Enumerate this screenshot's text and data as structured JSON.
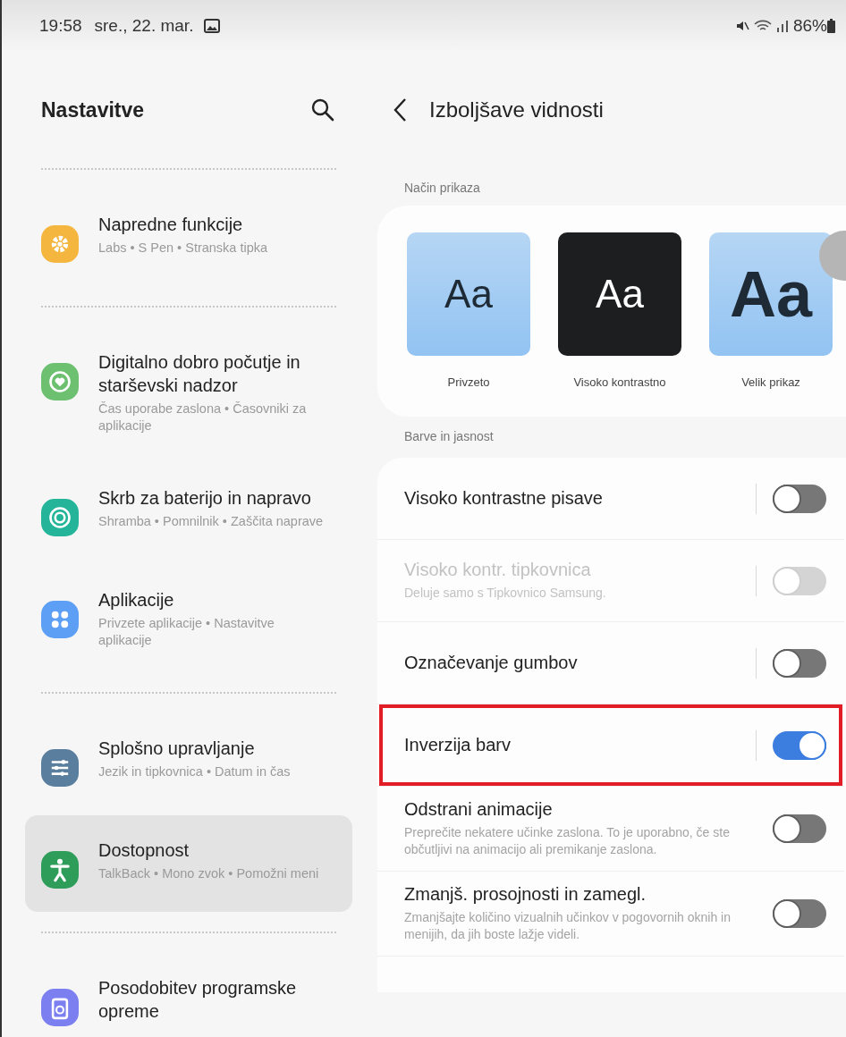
{
  "status_bar": {
    "time": "19:58",
    "date": "sre., 22. mar.",
    "battery": "86%"
  },
  "sidebar": {
    "title": "Nastavitve",
    "groups": [
      {
        "items": [
          {
            "color": "#f5b63f",
            "title": "Napredne funkcije",
            "subtitle": "Labs  •  S Pen  •  Stranska tipka",
            "selected": false
          }
        ]
      },
      {
        "items": [
          {
            "color": "#6cc070",
            "title": "Digitalno dobro počutje in starševski nadzor",
            "subtitle": "Čas uporabe zaslona  •  Časovniki za aplikacije",
            "selected": false
          },
          {
            "color": "#23b49a",
            "title": "Skrb za baterijo in napravo",
            "subtitle": "Shramba  •  Pomnilnik  •  Zaščita naprave",
            "selected": false
          },
          {
            "color": "#5c9ff5",
            "title": "Aplikacije",
            "subtitle": "Privzete aplikacije  •  Nastavitve aplikacije",
            "selected": false
          }
        ]
      },
      {
        "items": [
          {
            "color": "#5a7f9e",
            "title": "Splošno upravljanje",
            "subtitle": "Jezik in tipkovnica  •  Datum in čas",
            "selected": false
          },
          {
            "color": "#2e9d5a",
            "title": "Dostopnost",
            "subtitle": "TalkBack  •  Mono zvok  •  Pomožni meni",
            "selected": true
          }
        ]
      },
      {
        "items": [
          {
            "color": "#7b7ff0",
            "title": "Posodobitev programske opreme",
            "selected": false
          }
        ]
      }
    ]
  },
  "detail": {
    "title": "Izboljšave vidnosti",
    "display_section": "Način prikaza",
    "modes": [
      {
        "kind": "default",
        "sample": "Aa",
        "label": "Privzeto"
      },
      {
        "kind": "contrast",
        "sample": "Aa",
        "label": "Visoko kontrastno"
      },
      {
        "kind": "large",
        "sample": "Aa",
        "label": "Velik prikaz"
      }
    ],
    "color_section": "Barve in jasnost",
    "settings": [
      {
        "kind": "link_switch",
        "title": "Visoko kontrastne pisave",
        "on": false,
        "disabled": false,
        "highlighted": false
      },
      {
        "kind": "link_switch",
        "title": "Visoko kontr. tipkovnica",
        "description": "Deluje samo s Tipkovnico Samsung.",
        "on": false,
        "disabled": true,
        "highlighted": false
      },
      {
        "kind": "link_switch",
        "title": "Označevanje gumbov",
        "on": false,
        "disabled": false,
        "highlighted": false
      },
      {
        "kind": "link_switch",
        "title": "Inverzija barv",
        "on": true,
        "disabled": false,
        "highlighted": true
      },
      {
        "kind": "switch",
        "title": "Odstrani animacije",
        "description": "Preprečite nekatere učinke zaslona. To je uporabno, če ste občutljivi na animacijo ali premikanje zaslona.",
        "on": false,
        "disabled": false,
        "highlighted": false
      },
      {
        "kind": "switch",
        "title": "Zmanjš. prosojnosti in zamegl.",
        "description": "Zmanjšajte količino vizualnih učinkov v pogovornih oknih in menijih, da jih boste lažje videli.",
        "on": false,
        "disabled": false,
        "highlighted": false
      }
    ]
  }
}
